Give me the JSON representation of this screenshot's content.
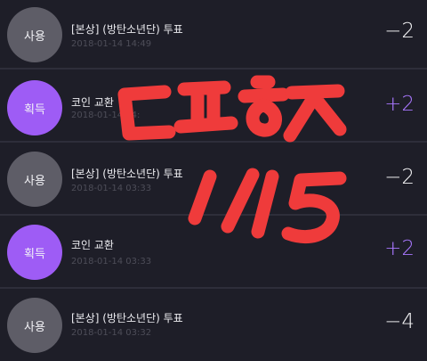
{
  "colors": {
    "background": "#1e1e28",
    "divider": "#2e2e3a",
    "use_badge": "#5e5d67",
    "gain_badge": "#9e5cf5",
    "positive_amount": "#a977ff",
    "negative_amount": "#f4f4f6",
    "handwriting": "#ef3b3b"
  },
  "transactions": [
    {
      "type": "use",
      "badge": "사용",
      "title": "[본상] (방탄소년단) 투표",
      "time": "2018-01-14 14:49",
      "amount": "−2"
    },
    {
      "type": "gain",
      "badge": "획득",
      "title": "코인 교환",
      "time": "2018-01-14 14:",
      "amount": "+2"
    },
    {
      "type": "use",
      "badge": "사용",
      "title": "[본상] (방탄소년단) 투표",
      "time": "2018-01-14 03:33",
      "amount": "−2"
    },
    {
      "type": "gain",
      "badge": "획득",
      "title": "코인 교환",
      "time": "2018-01-14 03:33",
      "amount": "+2"
    },
    {
      "type": "use",
      "badge": "사용",
      "title": "[본상] (방탄소년단) 투표",
      "time": "2018-01-14 03:32",
      "amount": "−4"
    }
  ],
  "handwriting": {
    "text": "ㄷㅍㅎㅈ 1/15",
    "icon": "handwritten-annotation"
  }
}
